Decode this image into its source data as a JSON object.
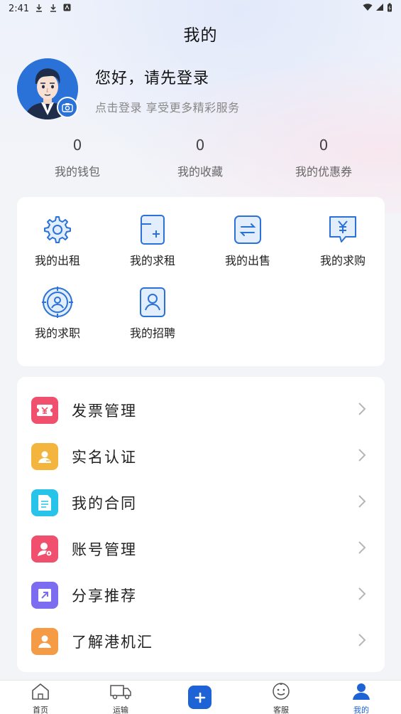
{
  "status_bar": {
    "time": "2:41"
  },
  "header": {
    "title": "我的"
  },
  "profile": {
    "greeting": "您好，请先登录",
    "subtitle": "点击登录 享受更多精彩服务"
  },
  "stats": [
    {
      "value": "0",
      "label": "我的钱包"
    },
    {
      "value": "0",
      "label": "我的收藏"
    },
    {
      "value": "0",
      "label": "我的优惠券"
    }
  ],
  "features": [
    {
      "label": "我的出租",
      "icon": "gear-icon"
    },
    {
      "label": "我的求租",
      "icon": "add-document-icon"
    },
    {
      "label": "我的出售",
      "icon": "exchange-icon"
    },
    {
      "label": "我的求购",
      "icon": "yuan-chat-icon"
    },
    {
      "label": "我的求职",
      "icon": "person-target-icon"
    },
    {
      "label": "我的招聘",
      "icon": "person-card-icon"
    }
  ],
  "menu": [
    {
      "label": "发票管理",
      "icon": "invoice-icon",
      "color": "#f0506e"
    },
    {
      "label": "实名认证",
      "icon": "id-card-icon",
      "color": "#f4b53f"
    },
    {
      "label": "我的合同",
      "icon": "contract-icon",
      "color": "#27c3e8"
    },
    {
      "label": "账号管理",
      "icon": "account-icon",
      "color": "#f0506e"
    },
    {
      "label": "分享推荐",
      "icon": "share-icon",
      "color": "#7b6cf0"
    },
    {
      "label": "了解港机汇",
      "icon": "about-icon",
      "color": "#f59a45"
    }
  ],
  "bottom_nav": [
    {
      "label": "首页",
      "icon": "home-icon"
    },
    {
      "label": "运输",
      "icon": "truck-icon"
    },
    {
      "label": "",
      "icon": "add-icon"
    },
    {
      "label": "客服",
      "icon": "service-icon"
    },
    {
      "label": "我的",
      "icon": "user-icon",
      "active": true
    }
  ],
  "colors": {
    "accent": "#1e63d6",
    "icon_blue": "#2a72d8"
  }
}
